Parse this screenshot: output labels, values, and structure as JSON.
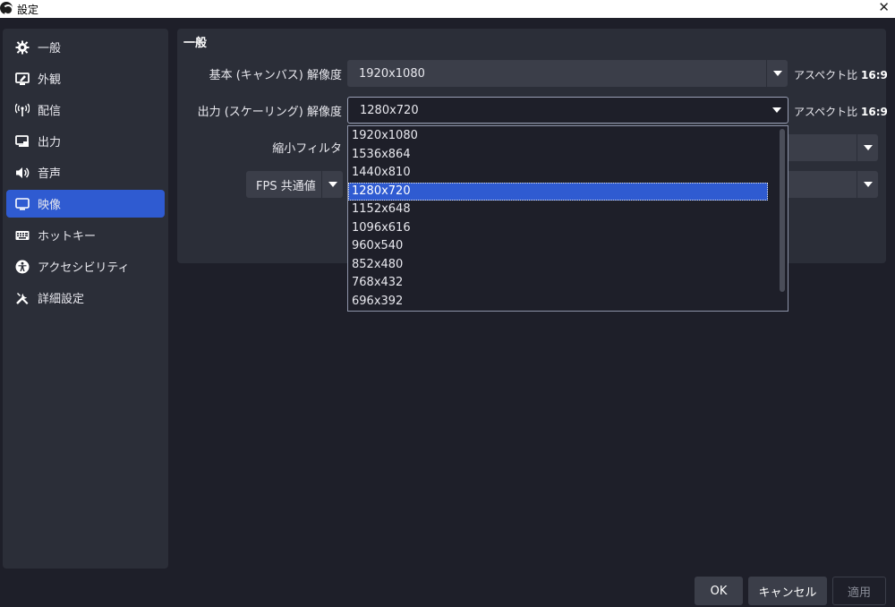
{
  "window": {
    "title": "設定",
    "close_glyph": "✕"
  },
  "sidebar": {
    "items": [
      {
        "label": "一般",
        "icon": "gear-icon"
      },
      {
        "label": "外観",
        "icon": "appearance-icon"
      },
      {
        "label": "配信",
        "icon": "broadcast-icon"
      },
      {
        "label": "出力",
        "icon": "output-icon"
      },
      {
        "label": "音声",
        "icon": "speaker-icon"
      },
      {
        "label": "映像",
        "icon": "monitor-icon",
        "active": true
      },
      {
        "label": "ホットキー",
        "icon": "keyboard-icon"
      },
      {
        "label": "アクセシビリティ",
        "icon": "accessibility-icon"
      },
      {
        "label": "詳細設定",
        "icon": "tools-icon"
      }
    ]
  },
  "video": {
    "section_title": "一般",
    "base_resolution": {
      "label": "基本 (キャンバス) 解像度",
      "value": "1920x1080"
    },
    "output_resolution": {
      "label": "出力 (スケーリング) 解像度",
      "value": "1280x720"
    },
    "aspect_prefix": "アスペクト比",
    "aspect_value": "16:9",
    "downscale_filter": {
      "label": "縮小フィルタ"
    },
    "fps_type": {
      "value": "FPS 共通値"
    }
  },
  "dropdown": {
    "options": [
      "1920x1080",
      "1536x864",
      "1440x810",
      "1280x720",
      "1152x648",
      "1096x616",
      "960x540",
      "852x480",
      "768x432",
      "696x392"
    ],
    "selected_index": 3
  },
  "buttons": {
    "ok": "OK",
    "cancel": "キャンセル",
    "apply": "適用"
  },
  "colors": {
    "accent": "#2f5bd1",
    "background": "#1e1f29",
    "panel": "#2b2e38",
    "control": "#3b3e49"
  }
}
